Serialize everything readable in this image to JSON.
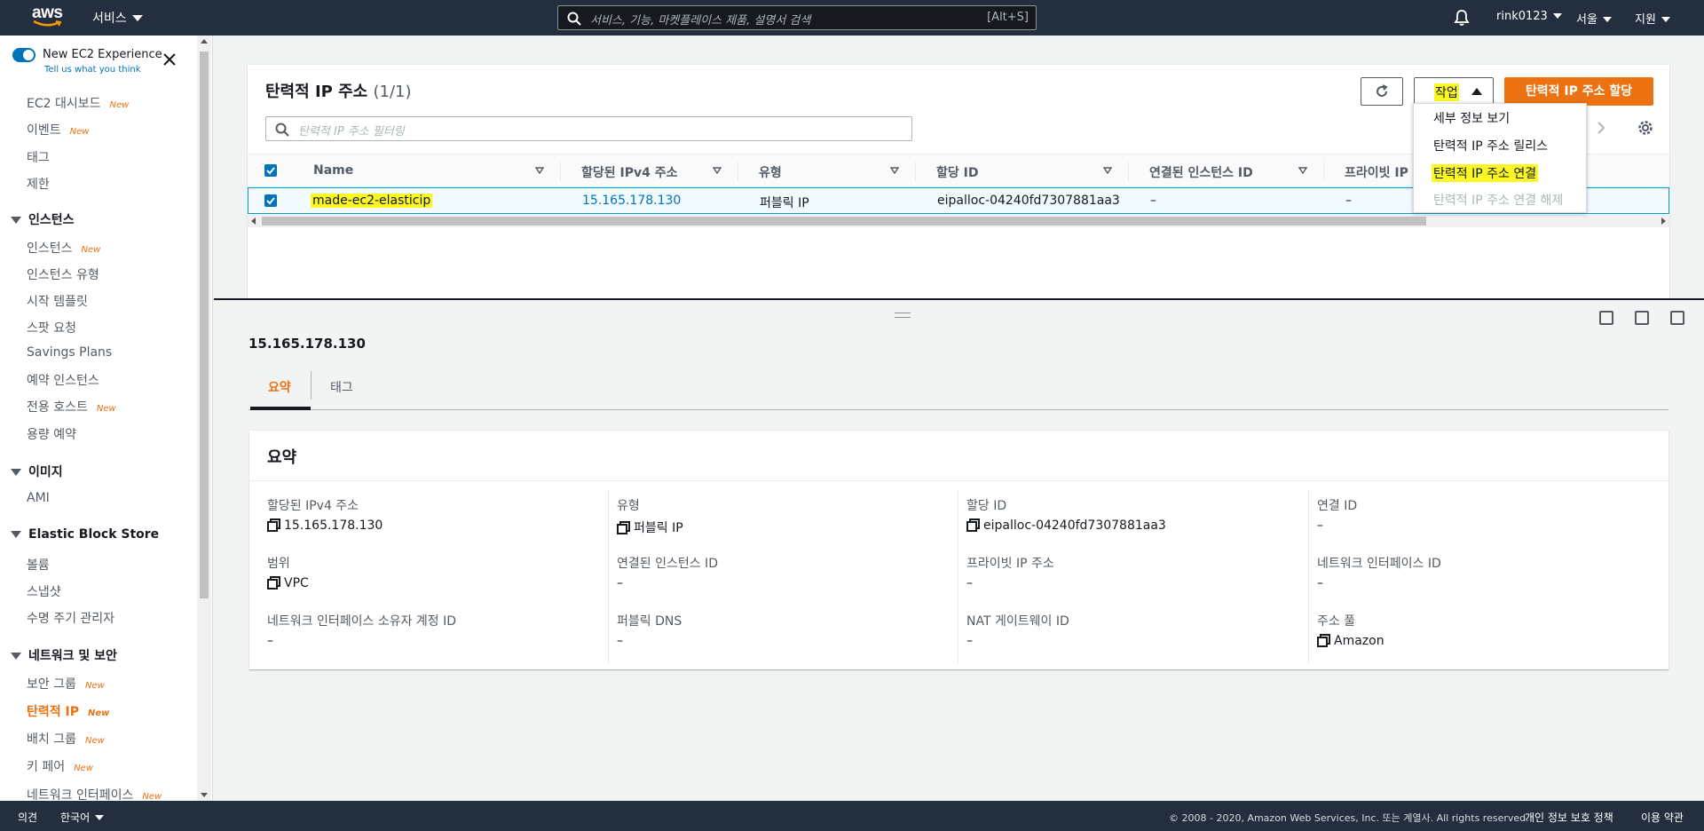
{
  "nav": {
    "logo": "aws",
    "services": "서비스",
    "search_placeholder": "서비스, 기능, 마켓플레이스 제품, 설명서 검색",
    "search_shortcut": "[Alt+S]",
    "account": "rink0123",
    "region": "서울",
    "support": "지원"
  },
  "sidebar": {
    "new_experience": "New EC2 Experience",
    "feedback_link": "Tell us what you think",
    "new_badge": "New",
    "items": [
      {
        "label": "EC2 대시보드",
        "badge": "New"
      },
      {
        "label": "이벤트",
        "badge": "New"
      },
      {
        "label": "태그",
        "badge": ""
      },
      {
        "label": "제한",
        "badge": ""
      }
    ],
    "sections": [
      {
        "title": "인스턴스",
        "items": [
          {
            "label": "인스턴스",
            "badge": "New"
          },
          {
            "label": "인스턴스 유형",
            "badge": ""
          },
          {
            "label": "시작 템플릿",
            "badge": ""
          },
          {
            "label": "스팟 요청",
            "badge": ""
          },
          {
            "label": "Savings Plans",
            "badge": ""
          },
          {
            "label": "예약 인스턴스",
            "badge": ""
          },
          {
            "label": "전용 호스트",
            "badge": "New"
          },
          {
            "label": "용량 예약",
            "badge": ""
          }
        ]
      },
      {
        "title": "이미지",
        "items": [
          {
            "label": "AMI",
            "badge": ""
          }
        ]
      },
      {
        "title": "Elastic Block Store",
        "items": [
          {
            "label": "볼륨",
            "badge": ""
          },
          {
            "label": "스냅샷",
            "badge": ""
          },
          {
            "label": "수명 주기 관리자",
            "badge": ""
          }
        ]
      },
      {
        "title": "네트워크 및 보안",
        "items": [
          {
            "label": "보안 그룹",
            "badge": "New"
          },
          {
            "label": "탄력적 IP",
            "badge": "New",
            "active": true
          },
          {
            "label": "배치 그룹",
            "badge": "New"
          },
          {
            "label": "키 페어",
            "badge": "New"
          },
          {
            "label": "네트워크 인터페이스",
            "badge": "New"
          }
        ]
      }
    ]
  },
  "table": {
    "title": "탄력적 IP 주소",
    "count": "(1/1)",
    "actions_label": "작업",
    "allocate_label": "탄력적 IP 주소 할당",
    "filter_placeholder": "탄력적 IP 주소 필터링",
    "columns": [
      "Name",
      "할당된 IPv4 주소",
      "유형",
      "할당 ID",
      "연결된 인스턴스 ID",
      "프라이빗 IP"
    ],
    "rows": [
      {
        "name": "made-ec2-elasticip",
        "ipv4": "15.165.178.130",
        "type": "퍼블릭 IP",
        "allocation_id": "eipalloc-04240fd7307881aa3",
        "instance_id": "–",
        "private_ip": "–"
      }
    ]
  },
  "actions_menu": {
    "items": [
      {
        "label": "세부 정보 보기",
        "disabled": false
      },
      {
        "label": "탄력적 IP 주소 릴리스",
        "disabled": false
      },
      {
        "label": "탄력적 IP 주소 연결",
        "disabled": false,
        "highlighted": true
      },
      {
        "label": "탄력적 IP 주소 연결 해제",
        "disabled": true
      }
    ]
  },
  "details": {
    "selected_ip": "15.165.178.130",
    "tabs": [
      "요약",
      "태그"
    ],
    "active_tab": "요약",
    "summary_title": "요약",
    "fields": [
      {
        "label": "할당된 IPv4 주소",
        "value": "15.165.178.130",
        "copy": true
      },
      {
        "label": "유형",
        "value": "퍼블릭 IP",
        "copy": true
      },
      {
        "label": "할당 ID",
        "value": "eipalloc-04240fd7307881aa3",
        "copy": true
      },
      {
        "label": "연결 ID",
        "value": "–",
        "copy": false
      },
      {
        "label": "범위",
        "value": "VPC",
        "copy": true
      },
      {
        "label": "연결된 인스턴스 ID",
        "value": "–",
        "copy": false
      },
      {
        "label": "프라이빗 IP 주소",
        "value": "–",
        "copy": false
      },
      {
        "label": "네트워크 인터페이스 ID",
        "value": "–",
        "copy": false
      },
      {
        "label": "네트워크 인터페이스 소유자 계정 ID",
        "value": "–",
        "copy": false
      },
      {
        "label": "퍼블릭 DNS",
        "value": "–",
        "copy": false
      },
      {
        "label": "NAT 게이트웨이 ID",
        "value": "–",
        "copy": false
      },
      {
        "label": "주소 풀",
        "value": "Amazon",
        "copy": true
      }
    ]
  },
  "footer": {
    "feedback": "의견",
    "language": "한국어",
    "copyright": "© 2008 - 2020, Amazon Web Services, Inc. 또는 계열사. All rights reserved.",
    "privacy": "개인 정보 보호 정책",
    "terms": "이용 약관"
  },
  "colors": {
    "nav_bg": "#232f3e",
    "accent": "#ec7211",
    "link": "#0073bb",
    "highlight": "#fbf724"
  }
}
